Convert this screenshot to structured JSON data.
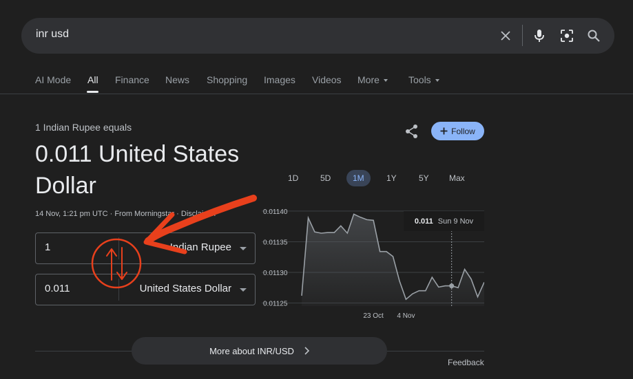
{
  "search": {
    "query": "inr usd"
  },
  "tabs": [
    {
      "label": "AI Mode"
    },
    {
      "label": "All",
      "active": true
    },
    {
      "label": "Finance"
    },
    {
      "label": "News"
    },
    {
      "label": "Shopping"
    },
    {
      "label": "Images"
    },
    {
      "label": "Videos"
    },
    {
      "label": "More"
    },
    {
      "label": "Tools"
    }
  ],
  "converter": {
    "equals_label": "1 Indian Rupee equals",
    "result_value": "0.011 United States Dollar",
    "meta": "14 Nov, 1:21 pm UTC · From Morningstar · Disclaimer",
    "from": {
      "amount": "1",
      "currency": "Indian Rupee"
    },
    "to": {
      "amount": "0.011",
      "currency": "United States Dollar"
    }
  },
  "actions": {
    "follow_label": "Follow",
    "share_icon": "share-icon"
  },
  "ranges": [
    "1D",
    "5D",
    "1M",
    "1Y",
    "5Y",
    "Max"
  ],
  "active_range": "1M",
  "tooltip": {
    "value": "0.011",
    "date": "Sun 9 Nov"
  },
  "chart_data": {
    "type": "area",
    "x_ticks": [
      "23 Oct",
      "4 Nov"
    ],
    "y_ticks": [
      "0.01140",
      "0.01135",
      "0.01130",
      "0.01125"
    ],
    "ylim": [
      0.011245,
      0.01141
    ],
    "y": [
      0.011262,
      0.011389,
      0.011366,
      0.011364,
      0.011365,
      0.011365,
      0.011376,
      0.011364,
      0.011395,
      0.01139,
      0.011386,
      0.011385,
      0.011334,
      0.011334,
      0.011326,
      0.011286,
      0.011256,
      0.011265,
      0.01127,
      0.01127,
      0.011292,
      0.011276,
      0.011278,
      0.011278,
      0.011275,
      0.011305,
      0.011289,
      0.01126,
      0.011284
    ],
    "series_color": "#9aa0a6",
    "highlight_index": 23,
    "grid": true
  },
  "annotation": {
    "color": "#e8401c"
  },
  "more_label": "More about INR/USD",
  "feedback_label": "Feedback"
}
